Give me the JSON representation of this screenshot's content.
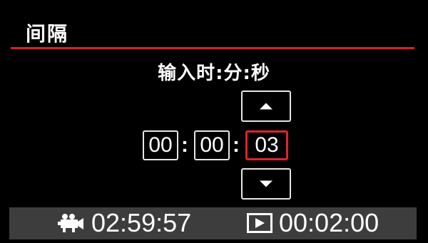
{
  "header": {
    "title": "间隔"
  },
  "prompt": "输入时:分:秒",
  "time_input": {
    "hours": "00",
    "minutes": "00",
    "seconds": "03",
    "separator": ":",
    "selected_field": "seconds"
  },
  "status_bar": {
    "movie_time": "02:59:57",
    "interval_time": "00:02:00",
    "movie_icon": "movie-camera-icon",
    "play_icon": "play-icon"
  },
  "colors": {
    "accent": "#d4202a",
    "status_bar_bg": "#3d3d3d",
    "background": "#000000"
  }
}
